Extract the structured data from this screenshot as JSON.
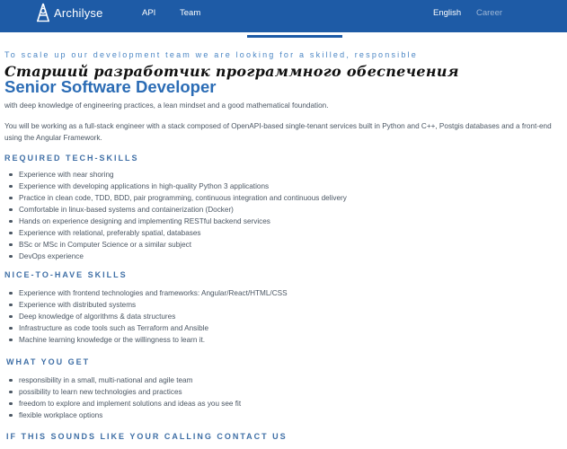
{
  "header": {
    "brand": "Archilyse",
    "nav": {
      "api": "API",
      "team": "Team"
    },
    "language": "English",
    "career": "Career"
  },
  "job": {
    "kicker": "To scale up our development team we are looking for a skilled, responsible",
    "title_ru": "Старший разработчик программного обеспечения",
    "title_en": "Senior Software Developer",
    "intro": "with deep knowledge of engineering practices, a lean mindset and a good mathematical foundation.",
    "description": "You will be working as a full-stack engineer with a stack composed of OpenAPI-based single-tenant services built in Python and C++, Postgis databases and a front-end using the Angular Framework."
  },
  "sections": [
    {
      "heading": "REQUIRED TECH-SKILLS",
      "items": [
        "Experience with near shoring",
        "Experience with developing applications in high-quality Python 3 applications",
        "Practice in clean code, TDD, BDD, pair programming, continuous integration and continuous delivery",
        "Comfortable in linux-based systems and containerization (Docker)",
        "Hands on experience designing and implementing RESTful backend services",
        "Experience with relational, preferably spatial, databases",
        "BSc or MSc in Computer Science or a similar subject",
        "DevOps experience"
      ]
    },
    {
      "heading": "NICE-TO-HAVE SKILLS",
      "items": [
        "Experience with frontend technologies and frameworks: Angular/React/HTML/CSS",
        "Experience with distributed systems",
        "Deep knowledge of algorithms & data structures",
        "Infrastructure as code tools such as Terraform and Ansible",
        "Machine learning knowledge or the willingness to learn it."
      ]
    },
    {
      "heading": "WHAT YOU GET",
      "items": [
        "responsibility in a small, multi-national and agile team",
        "possibility to learn new technologies and practices",
        "freedom to explore and implement solutions and ideas as you see fit",
        "flexible workplace options"
      ]
    },
    {
      "heading": "IF THIS SOUNDS LIKE YOUR CALLING CONTACT US",
      "items": []
    }
  ]
}
